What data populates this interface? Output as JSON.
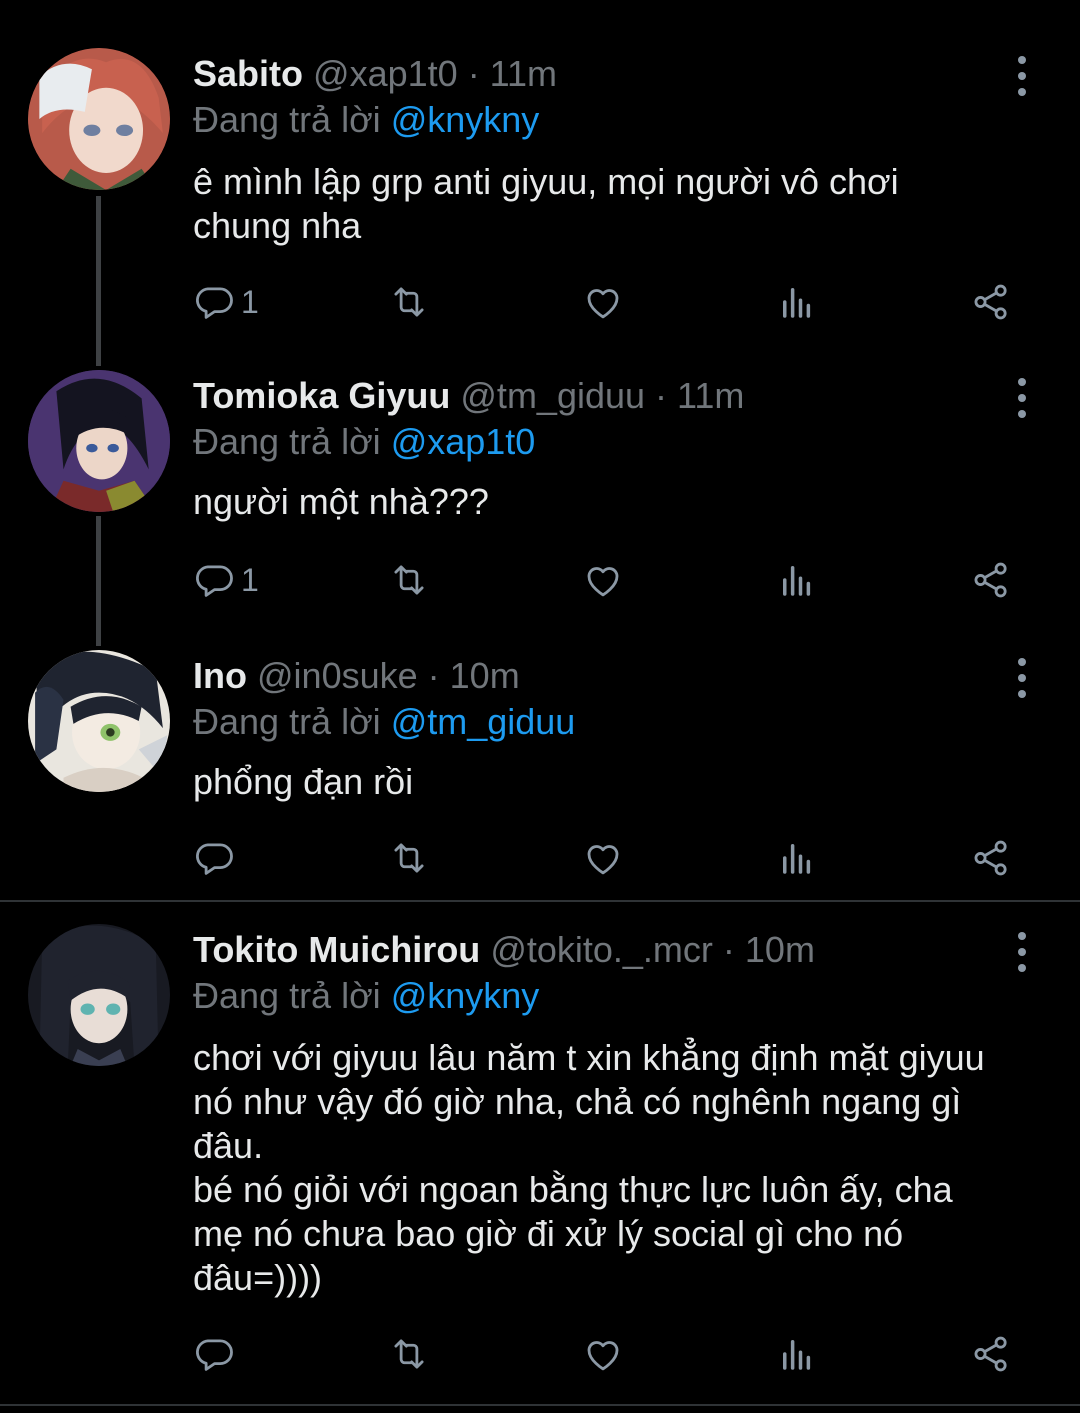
{
  "tweets": [
    {
      "name": "Sabito",
      "handle": "@xap1t0",
      "time": "· 11m",
      "reply_prefix": "Đang trả lời ",
      "reply_to": "@knykny",
      "text": "ê mình lập grp anti giyuu, mọi người vô chơi\nchung nha",
      "reply_count": "1"
    },
    {
      "name": "Tomioka Giyuu",
      "handle": "@tm_giduu",
      "time": "· 11m",
      "reply_prefix": "Đang trả lời ",
      "reply_to": "@xap1t0",
      "text": "người một nhà???",
      "reply_count": "1"
    },
    {
      "name": "Ino",
      "handle": "@in0suke",
      "time": "· 10m",
      "reply_prefix": "Đang trả lời ",
      "reply_to": "@tm_giduu",
      "text": "phổng đạn rồi",
      "reply_count": ""
    },
    {
      "name": "Tokito Muichirou",
      "handle": "@tokito._.mcr",
      "time": "· 10m",
      "reply_prefix": "Đang trả lời ",
      "reply_to": "@knykny",
      "text": "chơi với giyuu lâu năm t xin khẳng định mặt giyuu\nnó như vậy đó giờ nha, chả có nghênh ngang gì\nđâu.\nbé nó giỏi với ngoan bằng thực lực luôn ấy, cha\nmẹ nó chưa bao giờ đi xử lý social gì cho nó\nđâu=))))",
      "reply_count": ""
    }
  ],
  "colors": {
    "background": "#000000",
    "text": "#e7e9ea",
    "secondary": "#71767b",
    "mention": "#1d9bf0",
    "icon": "#8b98a5"
  },
  "icons": [
    "reply-icon",
    "retweet-icon",
    "like-icon",
    "analytics-icon",
    "share-icon",
    "more-options-icon"
  ]
}
